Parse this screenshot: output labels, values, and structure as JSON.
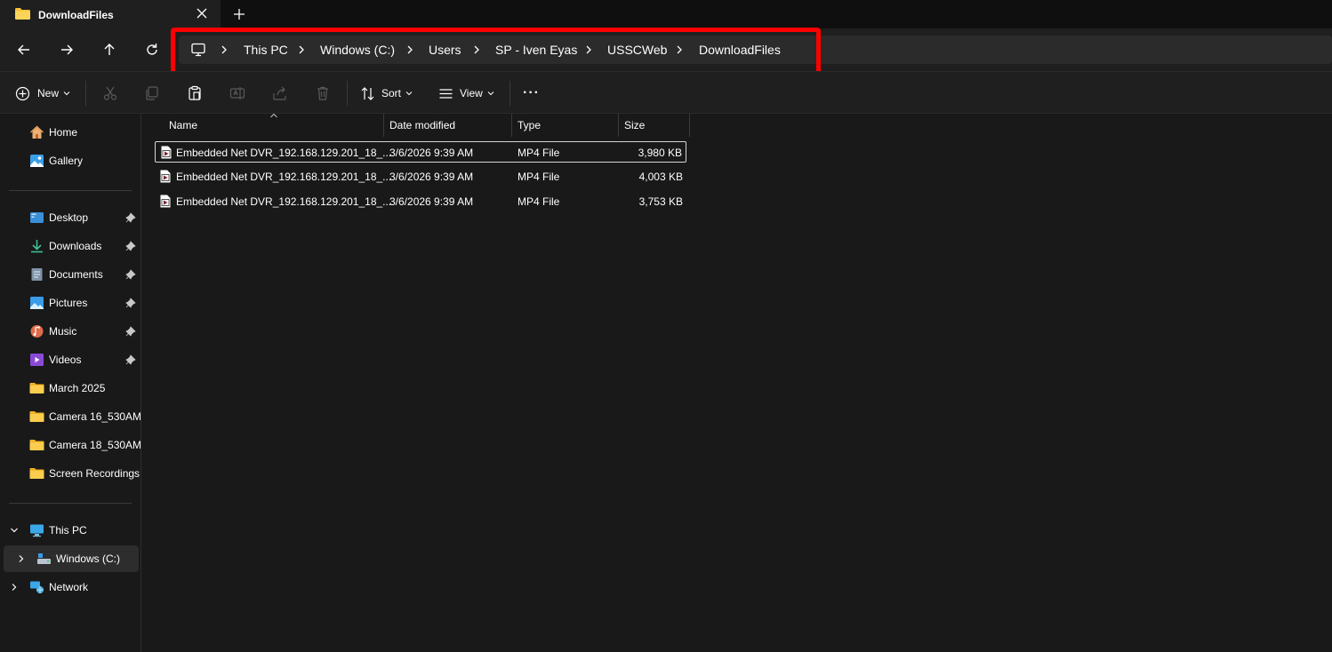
{
  "window": {
    "tab_title": "DownloadFiles",
    "new_tab_symbol": "+"
  },
  "address_bar": {
    "root_icon": "computer-icon",
    "crumbs": [
      "This PC",
      "Windows (C:)",
      "Users",
      "SP - Iven Eyas",
      "USSCWeb",
      "DownloadFiles"
    ]
  },
  "toolbar": {
    "new_label": "New",
    "sort_label": "Sort",
    "view_label": "View",
    "more_label": "···"
  },
  "sidebar": {
    "top": [
      {
        "label": "Home",
        "icon": "home-icon"
      },
      {
        "label": "Gallery",
        "icon": "gallery-icon"
      }
    ],
    "quick": [
      {
        "label": "Desktop",
        "icon": "desktop-icon",
        "pinned": true
      },
      {
        "label": "Downloads",
        "icon": "download-icon",
        "pinned": true
      },
      {
        "label": "Documents",
        "icon": "document-icon",
        "pinned": true
      },
      {
        "label": "Pictures",
        "icon": "pictures-icon",
        "pinned": true
      },
      {
        "label": "Music",
        "icon": "music-icon",
        "pinned": true
      },
      {
        "label": "Videos",
        "icon": "videos-icon",
        "pinned": true
      },
      {
        "label": "March 2025",
        "icon": "folder-icon"
      },
      {
        "label": "Camera 16_530AM",
        "icon": "folder-icon"
      },
      {
        "label": "Camera 18_530AM",
        "icon": "folder-icon"
      },
      {
        "label": "Screen Recordings",
        "icon": "folder-icon"
      }
    ],
    "tree": [
      {
        "label": "This PC",
        "icon": "computer-icon",
        "expanded": true
      },
      {
        "label": "Windows (C:)",
        "icon": "drive-icon",
        "selected": true
      },
      {
        "label": "Network",
        "icon": "network-icon"
      }
    ]
  },
  "file_list": {
    "columns": [
      "Name",
      "Date modified",
      "Type",
      "Size"
    ],
    "rows": [
      {
        "name": "Embedded Net DVR_192.168.129.201_18_...",
        "date": "3/6/2026 9:39 AM",
        "type": "MP4 File",
        "size": "3,980 KB"
      },
      {
        "name": "Embedded Net DVR_192.168.129.201_18_...",
        "date": "3/6/2026 9:39 AM",
        "type": "MP4 File",
        "size": "4,003 KB"
      },
      {
        "name": "Embedded Net DVR_192.168.129.201_18_...",
        "date": "3/6/2026 9:39 AM",
        "type": "MP4 File",
        "size": "3,753 KB"
      }
    ]
  },
  "colors": {
    "highlight": "#ff0000",
    "folder": "#f8c23a",
    "background": "#191919"
  }
}
